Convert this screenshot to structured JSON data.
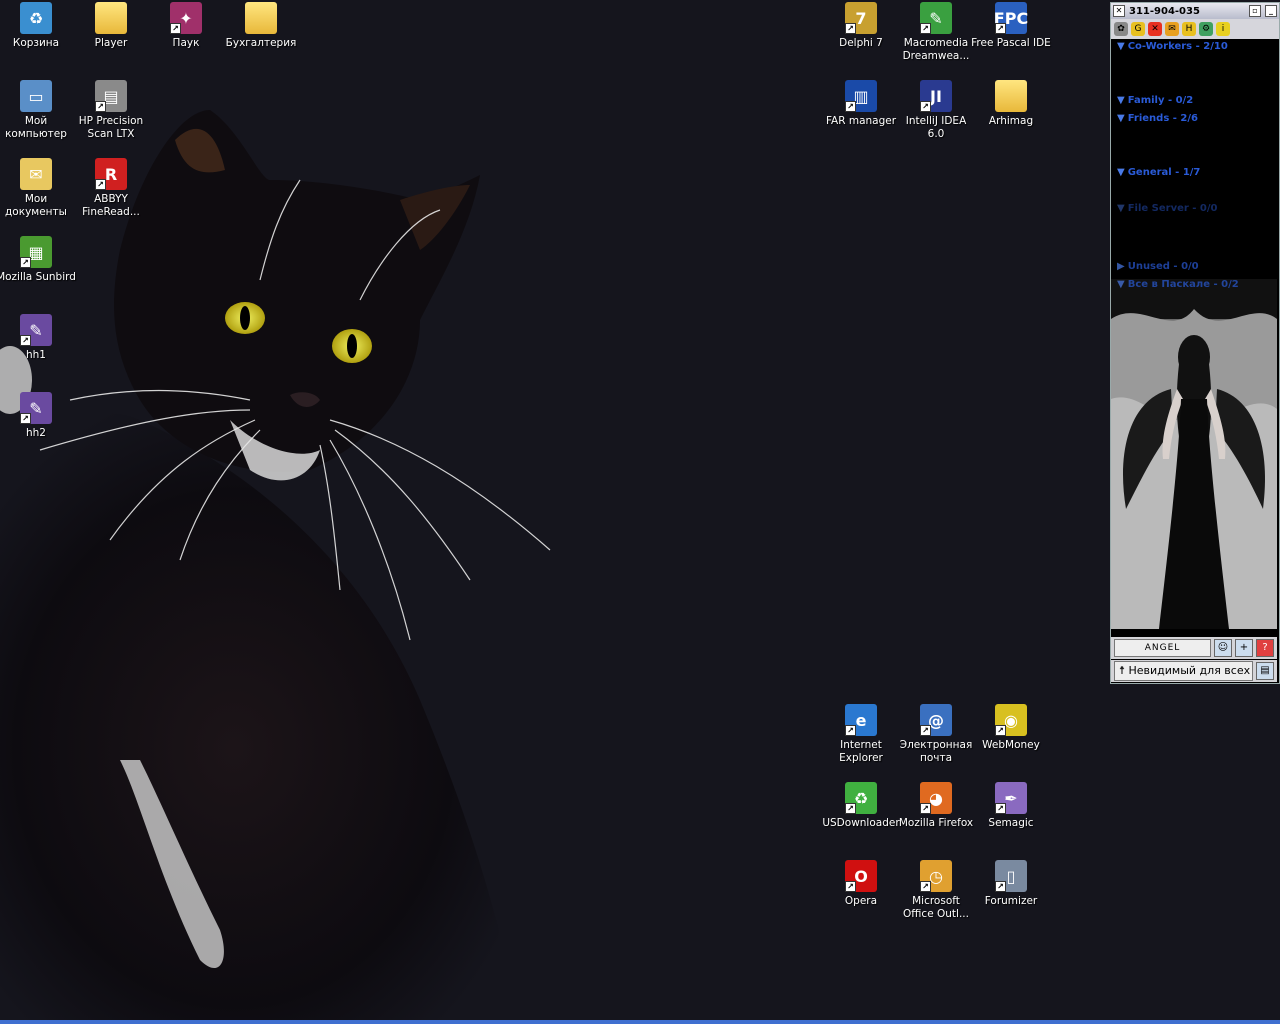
{
  "desktop": {
    "icons_left": [
      {
        "label": "Корзина",
        "icon": "recycle-bin-icon",
        "color": "#3a8fd0",
        "glyph": "♻"
      },
      {
        "label": "Player",
        "icon": "folder-icon",
        "color": "#e8b83a",
        "glyph": ""
      },
      {
        "label": "Паук",
        "icon": "spider-game-icon",
        "color": "#a0306a",
        "glyph": "✦"
      },
      {
        "label": "Бухгалтерия",
        "icon": "folder-icon",
        "color": "#e8b83a",
        "glyph": ""
      },
      {
        "label": "Мой компьютер",
        "icon": "my-computer-icon",
        "color": "#5a8fc8",
        "glyph": "▭"
      },
      {
        "label": "HP Precision Scan LTX",
        "icon": "scanner-icon",
        "color": "#8a8a8a",
        "glyph": "▤"
      },
      {
        "label": "Мои документы",
        "icon": "my-documents-icon",
        "color": "#e8c860",
        "glyph": "✉"
      },
      {
        "label": "ABBYY FineRead...",
        "icon": "abbyy-icon",
        "color": "#d02020",
        "glyph": "R"
      },
      {
        "label": "Mozilla Sunbird",
        "icon": "sunbird-icon",
        "color": "#4a9a30",
        "glyph": "▦"
      },
      {
        "label": "hh1",
        "icon": "djvu-icon",
        "color": "#6a4aa0",
        "glyph": "✎"
      },
      {
        "label": "hh2",
        "icon": "djvu-icon",
        "color": "#6a4aa0",
        "glyph": "✎"
      }
    ],
    "icons_right": [
      {
        "label": "Delphi 7",
        "icon": "delphi-icon",
        "color": "#c8a030",
        "glyph": "7"
      },
      {
        "label": "Macromedia Dreamwea...",
        "icon": "dreamweaver-icon",
        "color": "#3aa040",
        "glyph": "✎"
      },
      {
        "label": "Free Pascal IDE",
        "icon": "free-pascal-icon",
        "color": "#2a60c0",
        "glyph": "FPC"
      },
      {
        "label": "FAR manager",
        "icon": "far-manager-icon",
        "color": "#1a4aa8",
        "glyph": "▥"
      },
      {
        "label": "IntelliJ IDEA 6.0",
        "icon": "intellij-icon",
        "color": "#2a3a90",
        "glyph": "JI"
      },
      {
        "label": "Arhimag",
        "icon": "folder-icon",
        "color": "#e8b83a",
        "glyph": ""
      },
      {
        "label": "Internet Explorer",
        "icon": "internet-explorer-icon",
        "color": "#2a78d0",
        "glyph": "e"
      },
      {
        "label": "Электронная почта",
        "icon": "email-client-icon",
        "color": "#3a70c0",
        "glyph": "@"
      },
      {
        "label": "WebMoney",
        "icon": "webmoney-icon",
        "color": "#d8c020",
        "glyph": "◉"
      },
      {
        "label": "USDownloader",
        "icon": "usdownloader-icon",
        "color": "#40b040",
        "glyph": "♻"
      },
      {
        "label": "Mozilla Firefox",
        "icon": "firefox-icon",
        "color": "#e06a20",
        "glyph": "◕"
      },
      {
        "label": "Semagic",
        "icon": "semagic-icon",
        "color": "#8a6ac0",
        "glyph": "✒"
      },
      {
        "label": "Opera",
        "icon": "opera-icon",
        "color": "#d01010",
        "glyph": "O"
      },
      {
        "label": "Microsoft Office Outl...",
        "icon": "outlook-icon",
        "color": "#e0a030",
        "glyph": "◷"
      },
      {
        "label": "Forumizer",
        "icon": "forumizer-icon",
        "color": "#7a8aa0",
        "glyph": "▯"
      }
    ]
  },
  "contact_list": {
    "title": "311-904-035",
    "groups": [
      {
        "label": "Co-Workers - 2/10"
      },
      {
        "label": "Family - 0/2"
      },
      {
        "label": "Friends - 2/6"
      },
      {
        "label": "General - 1/7"
      },
      {
        "label": "File Server - 0/0"
      },
      {
        "label": "Unused - 0/0"
      },
      {
        "label": "Все в Паскале - 0/2"
      }
    ],
    "skin_button": "ANGEL",
    "status": "Невидимый для всех"
  }
}
